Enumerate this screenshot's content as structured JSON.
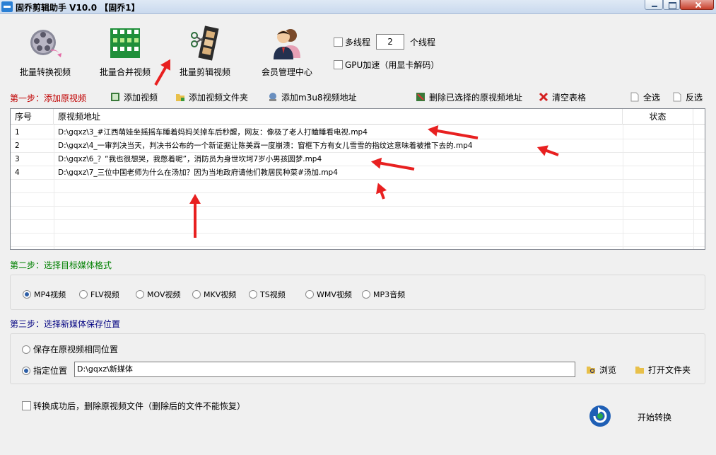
{
  "window": {
    "title": "固乔剪辑助手 V10.0 【固乔1】"
  },
  "toolbar": {
    "batch_convert": "批量转换视频",
    "batch_merge": "批量合并视频",
    "batch_edit": "批量剪辑视频",
    "member_center": "会员管理中心",
    "multithread_label": "多线程",
    "thread_count": "2",
    "thread_unit": "个线程",
    "gpu_label": "GPU加速（用显卡解码）"
  },
  "step1": {
    "label": "第一步：添加原视频",
    "add_video": "添加视频",
    "add_folder": "添加视频文件夹",
    "add_m3u8": "添加m3u8视频地址",
    "delete_selected": "删除已选择的原视频地址",
    "clear_table": "清空表格",
    "select_all": "全选",
    "invert_select": "反选"
  },
  "table": {
    "columns": [
      "序号",
      "原视频地址",
      "状态"
    ],
    "rows": [
      {
        "index": "1",
        "path": "D:\\gqxz\\3_#江西萌娃坐摇摇车睡着妈妈关掉车后秒醒，网友：像极了老人打瞌睡看电视.mp4",
        "status": ""
      },
      {
        "index": "2",
        "path": "D:\\gqxz\\4_一审判决当天，判决书公布的一个新证据让陈美霖一度崩溃：窗框下方有女儿雪雪的指纹这意味着被推下去的.mp4",
        "status": ""
      },
      {
        "index": "3",
        "path": "D:\\gqxz\\6_？“我也很想哭，我憋着呢”，消防员为身世坎坷7岁小男孩圆梦.mp4",
        "status": ""
      },
      {
        "index": "4",
        "path": "D:\\gqxz\\7_三位中国老师为什么在汤加？因为当地政府请他们教居民种菜#汤加.mp4",
        "status": ""
      }
    ]
  },
  "step2": {
    "label": "第二步：选择目标媒体格式",
    "formats": [
      "MP4视频",
      "FLV视频",
      "MOV视频",
      "MKV视频",
      "TS视频",
      "WMV视频",
      "MP3音频"
    ],
    "selected": "MP4视频"
  },
  "step3": {
    "label": "第三步：选择新媒体保存位置",
    "same_location": "保存在原视频相同位置",
    "specify_location": "指定位置",
    "path_value": "D:\\gqxz\\新媒体",
    "browse": "浏览",
    "open_folder": "打开文件夹"
  },
  "footer": {
    "delete_after": "转换成功后，删除原视频文件（删除后的文件不能恢复）",
    "start": "开始转换"
  },
  "colors": {
    "step1": "#c00000",
    "step2": "#008000",
    "step3": "#000080",
    "annotation_arrow": "#e82020"
  }
}
